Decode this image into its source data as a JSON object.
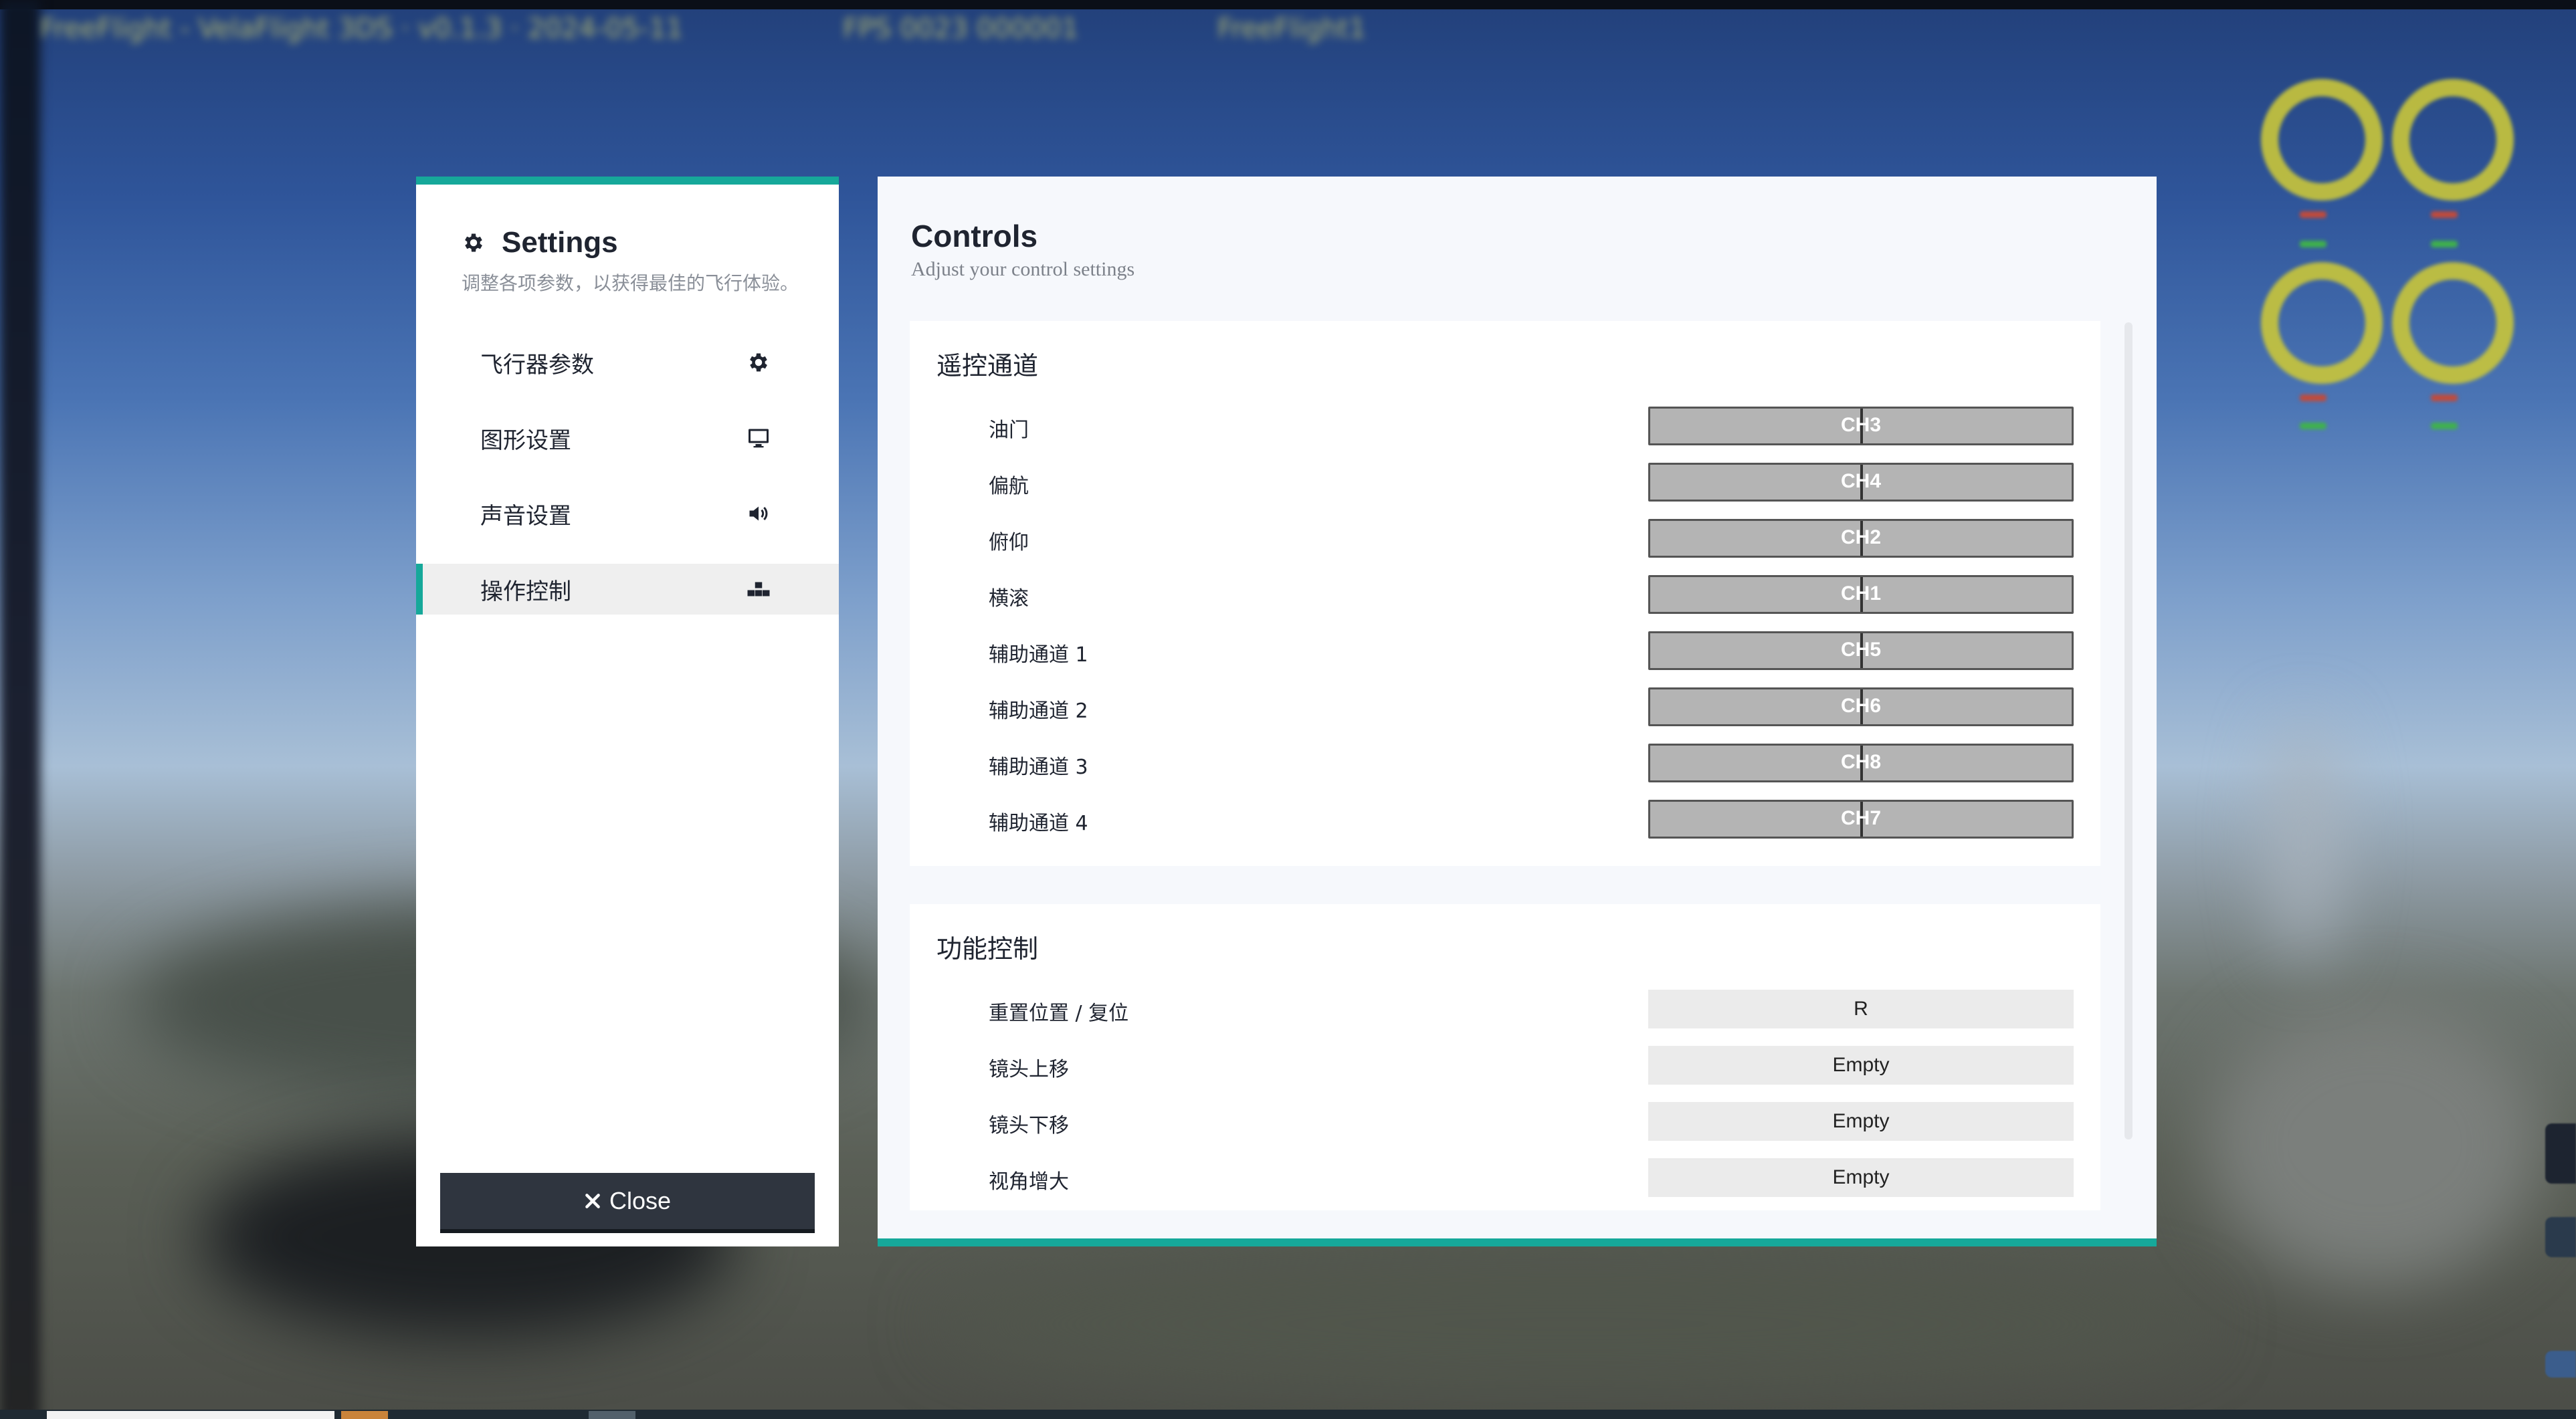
{
  "hud": {
    "top_text_1": "FreeFlight - VelaFlight 3DS · v0.1.3 · 2024-05-11",
    "top_text_2": "FPS 0023 000001",
    "top_text_3": "FreeFlight1"
  },
  "sidebar": {
    "title": "Settings",
    "subtitle": "调整各项参数，以获得最佳的飞行体验。",
    "items": [
      {
        "label": "飞行器参数",
        "icon": "gear-icon",
        "active": false
      },
      {
        "label": "图形设置",
        "icon": "monitor-icon",
        "active": false
      },
      {
        "label": "声音设置",
        "icon": "speaker-icon",
        "active": false
      },
      {
        "label": "操作控制",
        "icon": "controls-icon",
        "active": true
      }
    ],
    "close_label": "Close"
  },
  "panel": {
    "title": "Controls",
    "subtitle": "Adjust your control settings",
    "channels_section": {
      "title": "遥控通道",
      "rows": [
        {
          "label": "油门",
          "value": "CH3"
        },
        {
          "label": "偏航",
          "value": "CH4"
        },
        {
          "label": "俯仰",
          "value": "CH2"
        },
        {
          "label": "横滚",
          "value": "CH1"
        },
        {
          "label": "辅助通道 1",
          "value": "CH5"
        },
        {
          "label": "辅助通道 2",
          "value": "CH6"
        },
        {
          "label": "辅助通道 3",
          "value": "CH8"
        },
        {
          "label": "辅助通道 4",
          "value": "CH7"
        }
      ]
    },
    "functions_section": {
      "title": "功能控制",
      "rows": [
        {
          "label": "重置位置 / 复位",
          "value": "R"
        },
        {
          "label": "镜头上移",
          "value": "Empty"
        },
        {
          "label": "镜头下移",
          "value": "Empty"
        },
        {
          "label": "视角增大",
          "value": "Empty"
        }
      ]
    }
  },
  "colors": {
    "accent": "#16a89a",
    "close_button": "#2f353f",
    "channel_bar": "#b4b4b4",
    "key_field": "#ebebeb"
  }
}
